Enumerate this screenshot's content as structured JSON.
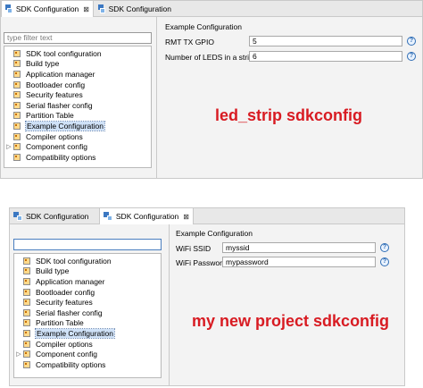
{
  "top": {
    "tabs": [
      {
        "label": "SDK Configuration",
        "close": "⊠"
      },
      {
        "label": "SDK Configuration"
      }
    ],
    "filter_placeholder": "type filter text",
    "tree": [
      "SDK tool configuration",
      "Build type",
      "Application manager",
      "Bootloader config",
      "Security features",
      "Serial flasher config",
      "Partition Table",
      "Example Configuration",
      "Compiler options",
      "Component config",
      "Compatibility options"
    ],
    "section_title": "Example Configuration",
    "fields": [
      {
        "label": "RMT TX GPIO",
        "value": "5"
      },
      {
        "label": "Number of LEDS in a strip",
        "value": "6"
      }
    ],
    "annotation": "led_strip sdkconfig"
  },
  "bottom": {
    "tabs": [
      {
        "label": "SDK Configuration"
      },
      {
        "label": "SDK Configuration",
        "close": "⊠"
      }
    ],
    "filter_value": "",
    "tree": [
      "SDK tool configuration",
      "Build type",
      "Application manager",
      "Bootloader config",
      "Security features",
      "Serial flasher config",
      "Partition Table",
      "Example Configuration",
      "Compiler options",
      "Component config",
      "Compatibility options"
    ],
    "section_title": "Example Configuration",
    "fields": [
      {
        "label": "WiFi SSID",
        "value": "myssid"
      },
      {
        "label": "WiFi Password",
        "value": "mypassword"
      }
    ],
    "annotation": "my new project sdkconfig"
  },
  "colors": {
    "annotation": "#d81b22",
    "selection": "#cfe1f7",
    "help": "#2f6db5"
  },
  "icons": {
    "help": "?",
    "expand": "▷",
    "close": "⊠"
  }
}
